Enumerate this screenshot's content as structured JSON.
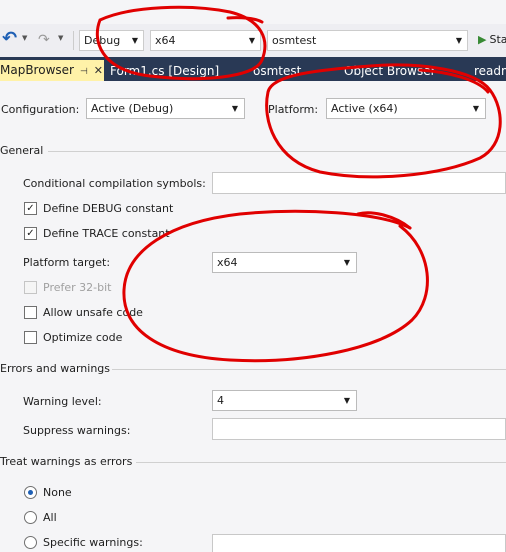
{
  "toolbar": {
    "undo_icon": "undo-icon",
    "redo_icon": "redo-icon",
    "config_combo": "Debug",
    "platform_combo": "x64",
    "project_combo": "osmtest",
    "start_label": "Sta"
  },
  "tabs": [
    {
      "label": "MapBrowser",
      "active": true
    },
    {
      "label": "Form1.cs [Design]"
    },
    {
      "label": "osmtest"
    },
    {
      "label": "Object Browser"
    },
    {
      "label": "readm"
    }
  ],
  "config_bar": {
    "configuration_label": "Configuration:",
    "configuration_value": "Active (Debug)",
    "platform_label": "Platform:",
    "platform_value": "Active (x64)"
  },
  "general": {
    "header": "General",
    "conditional_symbols_label": "Conditional compilation symbols:",
    "conditional_symbols_value": "",
    "define_debug_label": "Define DEBUG constant",
    "define_trace_label": "Define TRACE constant",
    "platform_target_label": "Platform target:",
    "platform_target_value": "x64",
    "prefer32_label": "Prefer 32-bit",
    "allow_unsafe_label": "Allow unsafe code",
    "optimize_label": "Optimize code"
  },
  "errors": {
    "header": "Errors and warnings",
    "warning_level_label": "Warning level:",
    "warning_level_value": "4",
    "suppress_label": "Suppress warnings:",
    "suppress_value": ""
  },
  "treat_warnings": {
    "header": "Treat warnings as errors",
    "none_label": "None",
    "all_label": "All",
    "specific_label": "Specific warnings:"
  },
  "colors": {
    "tabbar_bg": "#293955",
    "active_tab_bg": "#fff2a8",
    "annotation": "#e00000"
  }
}
